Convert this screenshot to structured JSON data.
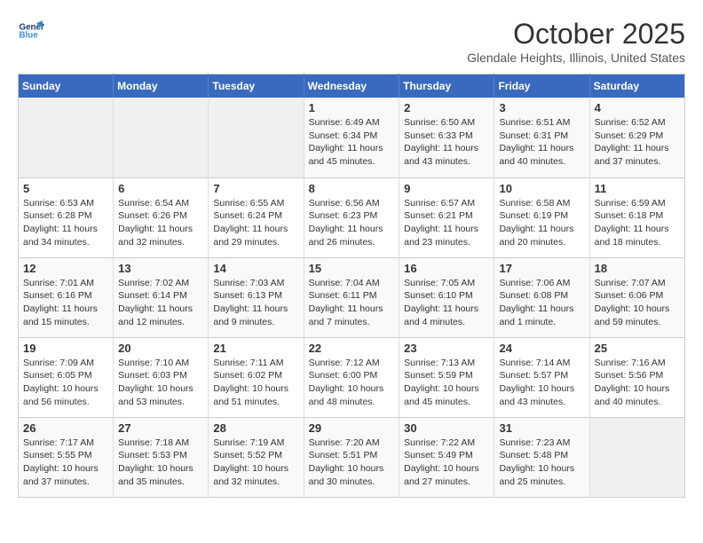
{
  "header": {
    "logo_line1": "General",
    "logo_line2": "Blue",
    "month": "October 2025",
    "location": "Glendale Heights, Illinois, United States"
  },
  "days_of_week": [
    "Sunday",
    "Monday",
    "Tuesday",
    "Wednesday",
    "Thursday",
    "Friday",
    "Saturday"
  ],
  "weeks": [
    [
      {
        "day": "",
        "info": ""
      },
      {
        "day": "",
        "info": ""
      },
      {
        "day": "",
        "info": ""
      },
      {
        "day": "1",
        "info": "Sunrise: 6:49 AM\nSunset: 6:34 PM\nDaylight: 11 hours\nand 45 minutes."
      },
      {
        "day": "2",
        "info": "Sunrise: 6:50 AM\nSunset: 6:33 PM\nDaylight: 11 hours\nand 43 minutes."
      },
      {
        "day": "3",
        "info": "Sunrise: 6:51 AM\nSunset: 6:31 PM\nDaylight: 11 hours\nand 40 minutes."
      },
      {
        "day": "4",
        "info": "Sunrise: 6:52 AM\nSunset: 6:29 PM\nDaylight: 11 hours\nand 37 minutes."
      }
    ],
    [
      {
        "day": "5",
        "info": "Sunrise: 6:53 AM\nSunset: 6:28 PM\nDaylight: 11 hours\nand 34 minutes."
      },
      {
        "day": "6",
        "info": "Sunrise: 6:54 AM\nSunset: 6:26 PM\nDaylight: 11 hours\nand 32 minutes."
      },
      {
        "day": "7",
        "info": "Sunrise: 6:55 AM\nSunset: 6:24 PM\nDaylight: 11 hours\nand 29 minutes."
      },
      {
        "day": "8",
        "info": "Sunrise: 6:56 AM\nSunset: 6:23 PM\nDaylight: 11 hours\nand 26 minutes."
      },
      {
        "day": "9",
        "info": "Sunrise: 6:57 AM\nSunset: 6:21 PM\nDaylight: 11 hours\nand 23 minutes."
      },
      {
        "day": "10",
        "info": "Sunrise: 6:58 AM\nSunset: 6:19 PM\nDaylight: 11 hours\nand 20 minutes."
      },
      {
        "day": "11",
        "info": "Sunrise: 6:59 AM\nSunset: 6:18 PM\nDaylight: 11 hours\nand 18 minutes."
      }
    ],
    [
      {
        "day": "12",
        "info": "Sunrise: 7:01 AM\nSunset: 6:16 PM\nDaylight: 11 hours\nand 15 minutes."
      },
      {
        "day": "13",
        "info": "Sunrise: 7:02 AM\nSunset: 6:14 PM\nDaylight: 11 hours\nand 12 minutes."
      },
      {
        "day": "14",
        "info": "Sunrise: 7:03 AM\nSunset: 6:13 PM\nDaylight: 11 hours\nand 9 minutes."
      },
      {
        "day": "15",
        "info": "Sunrise: 7:04 AM\nSunset: 6:11 PM\nDaylight: 11 hours\nand 7 minutes."
      },
      {
        "day": "16",
        "info": "Sunrise: 7:05 AM\nSunset: 6:10 PM\nDaylight: 11 hours\nand 4 minutes."
      },
      {
        "day": "17",
        "info": "Sunrise: 7:06 AM\nSunset: 6:08 PM\nDaylight: 11 hours\nand 1 minute."
      },
      {
        "day": "18",
        "info": "Sunrise: 7:07 AM\nSunset: 6:06 PM\nDaylight: 10 hours\nand 59 minutes."
      }
    ],
    [
      {
        "day": "19",
        "info": "Sunrise: 7:09 AM\nSunset: 6:05 PM\nDaylight: 10 hours\nand 56 minutes."
      },
      {
        "day": "20",
        "info": "Sunrise: 7:10 AM\nSunset: 6:03 PM\nDaylight: 10 hours\nand 53 minutes."
      },
      {
        "day": "21",
        "info": "Sunrise: 7:11 AM\nSunset: 6:02 PM\nDaylight: 10 hours\nand 51 minutes."
      },
      {
        "day": "22",
        "info": "Sunrise: 7:12 AM\nSunset: 6:00 PM\nDaylight: 10 hours\nand 48 minutes."
      },
      {
        "day": "23",
        "info": "Sunrise: 7:13 AM\nSunset: 5:59 PM\nDaylight: 10 hours\nand 45 minutes."
      },
      {
        "day": "24",
        "info": "Sunrise: 7:14 AM\nSunset: 5:57 PM\nDaylight: 10 hours\nand 43 minutes."
      },
      {
        "day": "25",
        "info": "Sunrise: 7:16 AM\nSunset: 5:56 PM\nDaylight: 10 hours\nand 40 minutes."
      }
    ],
    [
      {
        "day": "26",
        "info": "Sunrise: 7:17 AM\nSunset: 5:55 PM\nDaylight: 10 hours\nand 37 minutes."
      },
      {
        "day": "27",
        "info": "Sunrise: 7:18 AM\nSunset: 5:53 PM\nDaylight: 10 hours\nand 35 minutes."
      },
      {
        "day": "28",
        "info": "Sunrise: 7:19 AM\nSunset: 5:52 PM\nDaylight: 10 hours\nand 32 minutes."
      },
      {
        "day": "29",
        "info": "Sunrise: 7:20 AM\nSunset: 5:51 PM\nDaylight: 10 hours\nand 30 minutes."
      },
      {
        "day": "30",
        "info": "Sunrise: 7:22 AM\nSunset: 5:49 PM\nDaylight: 10 hours\nand 27 minutes."
      },
      {
        "day": "31",
        "info": "Sunrise: 7:23 AM\nSunset: 5:48 PM\nDaylight: 10 hours\nand 25 minutes."
      },
      {
        "day": "",
        "info": ""
      }
    ]
  ]
}
